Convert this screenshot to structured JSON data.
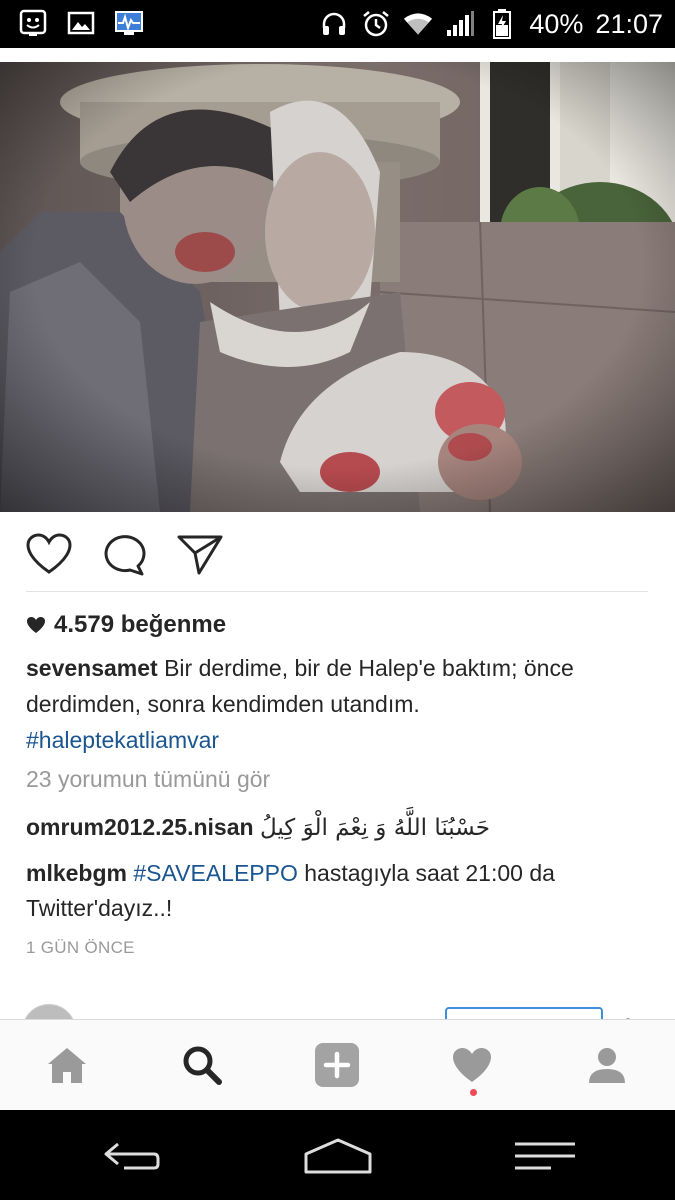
{
  "status_bar": {
    "left_icons": [
      "notification-face-icon",
      "image-icon",
      "monitor-pulse-icon"
    ],
    "right_icons": [
      "headphones-icon",
      "alarm-icon",
      "wifi-icon",
      "signal-icon",
      "battery-icon"
    ],
    "battery": "40%",
    "time": "21:07"
  },
  "post": {
    "likes": "4.579 beğenme",
    "caption": {
      "username": "sevensamet",
      "text": "Bir derdime, bir de Halep'e baktım; önce derdimden, sonra kendimden utandım.",
      "hashtag": "#haleptekatliamvar"
    },
    "view_all_comments": "23 yorumun tümünü gör",
    "comments": [
      {
        "username": "omrum2012.25.nisan",
        "text": "حَسْبُنَا اللَّهُ وَ نِعْمَ الْوَ كِيلُ",
        "hashtag": "",
        "rest": ""
      },
      {
        "username": "mlkebgm",
        "text": "",
        "hashtag": "#SAVEALEPPO",
        "rest": "hastagıyla saat 21:00 da Twitter'dayız..!"
      }
    ],
    "timestamp": "1 GÜN ÖNCE"
  },
  "bottom_nav": {
    "items": [
      "home-icon",
      "search-icon",
      "add-post-icon",
      "activity-heart-icon",
      "profile-icon"
    ],
    "active": "search-icon"
  },
  "system_nav": [
    "back-icon",
    "home-outline-icon",
    "recents-icon"
  ],
  "colors": {
    "hashtag": "#1a5590",
    "text": "#262626",
    "muted": "#999999",
    "notification": "#ed4956",
    "follow_border": "#3f8fde"
  }
}
